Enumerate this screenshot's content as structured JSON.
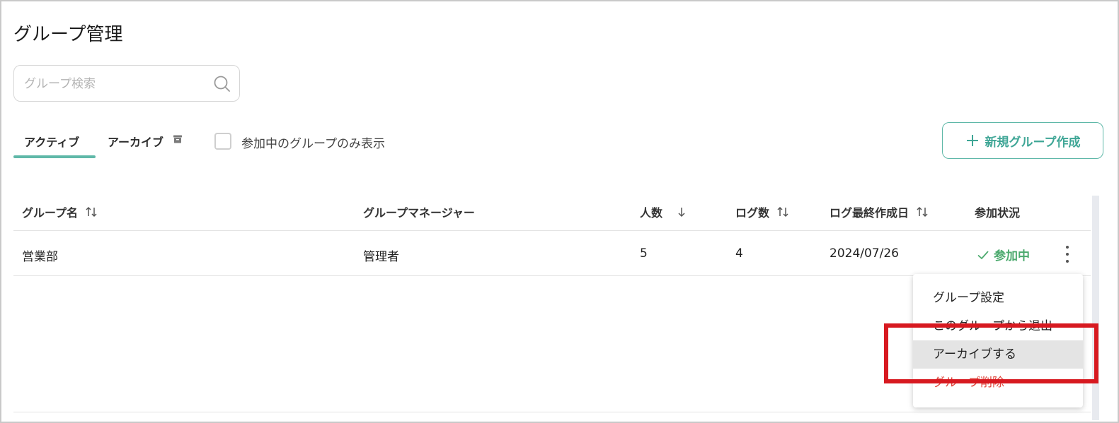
{
  "page": {
    "title": "グループ管理"
  },
  "search": {
    "placeholder": "グループ検索",
    "value": ""
  },
  "tabs": [
    {
      "label": "アクティブ",
      "active": true
    },
    {
      "label": "アーカイブ",
      "active": false,
      "icon": "archive-icon"
    }
  ],
  "filter": {
    "label": "参加中のグループのみ表示",
    "checked": false
  },
  "new_button": {
    "label": "新規グループ作成",
    "icon": "plus-icon"
  },
  "table": {
    "columns": [
      {
        "label": "グループ名",
        "sort": "sortable"
      },
      {
        "label": "グループマネージャー",
        "sort": "none"
      },
      {
        "label": "人数",
        "sort": "descending"
      },
      {
        "label": "ログ数",
        "sort": "sortable"
      },
      {
        "label": "ログ最終作成日",
        "sort": "sortable"
      },
      {
        "label": "参加状況",
        "sort": "none"
      }
    ],
    "rows": [
      {
        "name": "営業部",
        "manager": "管理者",
        "members": "5",
        "logs": "4",
        "last_log_date": "2024/07/26",
        "status": "参加中"
      }
    ]
  },
  "row_menu": {
    "items": [
      {
        "label": "グループ設定"
      },
      {
        "label": "このグループから退出"
      },
      {
        "label": "アーカイブする",
        "hovered": true
      },
      {
        "label": "グループ削除",
        "danger": true
      }
    ]
  },
  "colors": {
    "accent": "#5fb8a8",
    "accent_text": "#3fa696",
    "status_green": "#4caa6e",
    "danger": "#e0463c",
    "highlight_red": "#d71920"
  }
}
